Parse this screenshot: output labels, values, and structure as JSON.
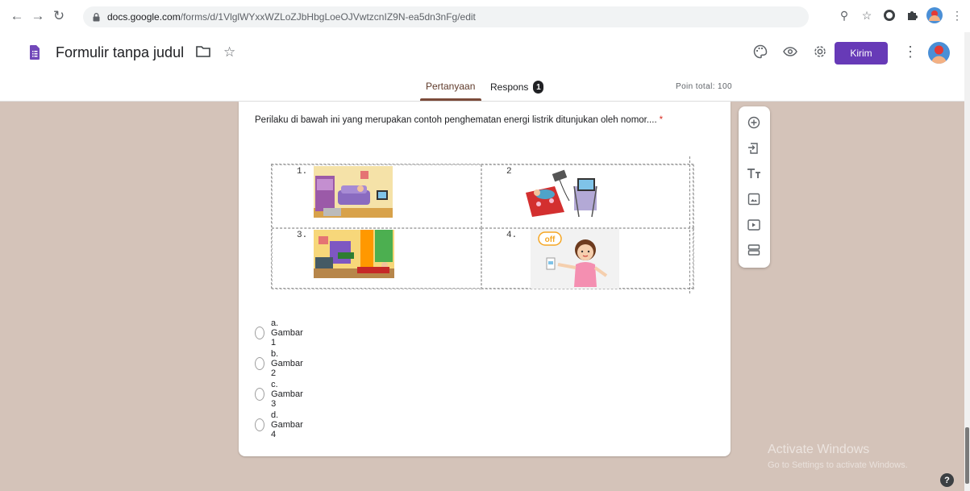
{
  "browser": {
    "url_host": "docs.google.com",
    "url_path": "/forms/d/1VlglWYxxWZLoZJbHbgLoeOJVwtzcnIZ9N-ea5dn3nFg/edit"
  },
  "header": {
    "title": "Formulir tanpa judul",
    "send_label": "Kirim"
  },
  "tabs": {
    "questions": "Pertanyaan",
    "responses": "Respons",
    "responses_count": "1",
    "total_points": "Poin total: 100"
  },
  "question": {
    "text": "Perilaku di bawah ini  yang merupakan contoh penghematan energi listrik ditunjukan oleh nomor....",
    "required_mark": "*",
    "table_labels": [
      "1.",
      "2",
      "3.",
      "4."
    ],
    "off_sign": "off",
    "options": [
      "a. Gambar 1",
      "b. Gambar 2",
      "c. Gambar 3",
      "d. Gambar 4"
    ]
  },
  "watermark": {
    "title": "Activate Windows",
    "subtitle": "Go to Settings to activate Windows."
  },
  "help": "?",
  "colors": {
    "accent": "#673ab7",
    "background": "#d4c3b9",
    "tab_underline": "#7b4b3a",
    "required": "#d93025"
  }
}
